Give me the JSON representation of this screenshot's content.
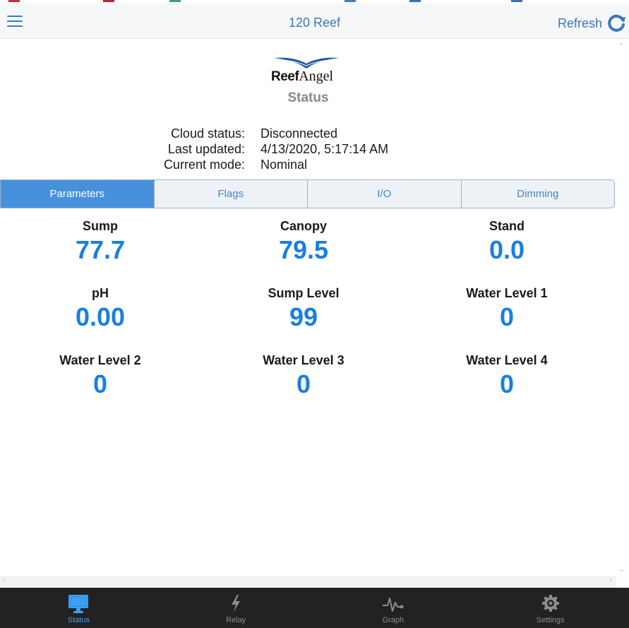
{
  "header": {
    "title": "120 Reef",
    "refresh_label": "Refresh"
  },
  "logo": {
    "bold": "Reef",
    "rest": "Angel"
  },
  "page_title": "Status",
  "info": [
    {
      "key": "Cloud status:",
      "value": "Disconnected"
    },
    {
      "key": "Last updated:",
      "value": "4/13/2020, 5:17:14 AM"
    },
    {
      "key": "Current mode:",
      "value": "Nominal"
    }
  ],
  "tabs": [
    {
      "label": "Parameters",
      "active": true
    },
    {
      "label": "Flags",
      "active": false
    },
    {
      "label": "I/O",
      "active": false
    },
    {
      "label": "Dimming",
      "active": false
    }
  ],
  "params": [
    {
      "label": "Sump",
      "value": "77.7"
    },
    {
      "label": "Canopy",
      "value": "79.5"
    },
    {
      "label": "Stand",
      "value": "0.0"
    },
    {
      "label": "pH",
      "value": "0.00"
    },
    {
      "label": "Sump Level",
      "value": "99"
    },
    {
      "label": "Water Level 1",
      "value": "0"
    },
    {
      "label": "Water Level 2",
      "value": "0"
    },
    {
      "label": "Water Level 3",
      "value": "0"
    },
    {
      "label": "Water Level 4",
      "value": "0"
    }
  ],
  "nav": [
    {
      "label": "Status",
      "icon": "monitor-icon",
      "active": true
    },
    {
      "label": "Relay",
      "icon": "lightning-icon",
      "active": false
    },
    {
      "label": "Graph",
      "icon": "pulse-graph-icon",
      "active": false
    },
    {
      "label": "Settings",
      "icon": "gear-icon",
      "active": false
    }
  ],
  "colors": {
    "accent": "#3a77b8",
    "value_blue": "#1a7fe0",
    "active_tab": "#4791dc",
    "nav_bg": "#222222",
    "nav_active": "#3fa0f2"
  }
}
